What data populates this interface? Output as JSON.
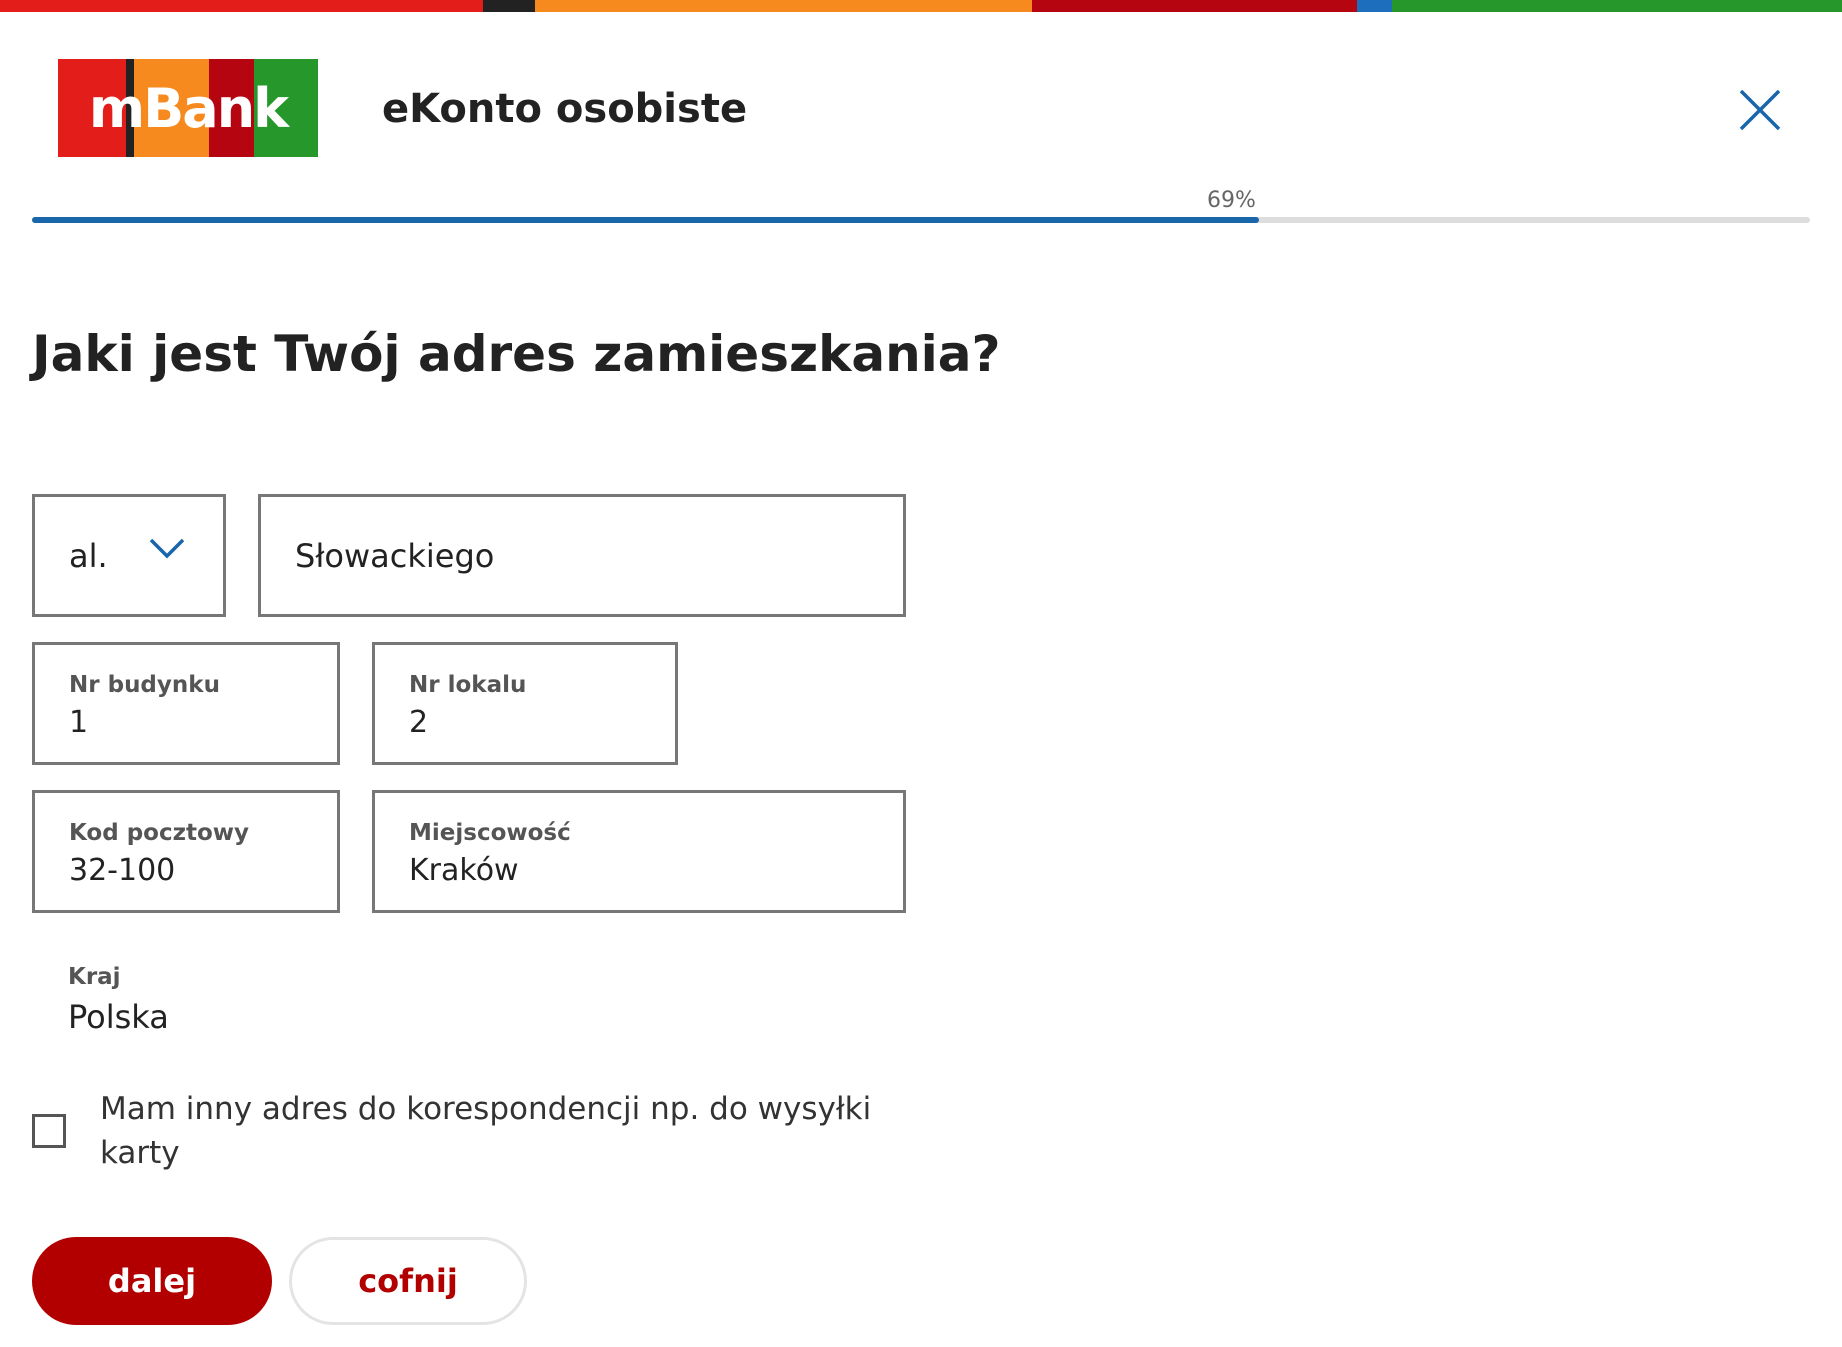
{
  "colors": {
    "stripe": [
      "#e31d1a",
      "#222222",
      "#f68a1e",
      "#b50510",
      "#1d6fbd",
      "#26972a"
    ],
    "logo_segments": [
      "#e31d1a",
      "#222222",
      "#f68a1e",
      "#b50510",
      "#26972a"
    ],
    "accent": "#1a66aa",
    "primary_button": "#b20000"
  },
  "header": {
    "logo_text": "mBank",
    "product_title": "eKonto osobiste",
    "close_icon": "close-icon"
  },
  "progress": {
    "label": "69%",
    "value_percent": 69
  },
  "page": {
    "title": "Jaki jest Twój adres zamieszkania?"
  },
  "form": {
    "street_type": {
      "selected": "al.",
      "icon": "chevron-down-icon"
    },
    "street_name": {
      "value": "Słowackiego"
    },
    "building_number": {
      "label": "Nr budynku",
      "value": "1"
    },
    "apartment_number": {
      "label": "Nr lokalu",
      "value": "2"
    },
    "postal_code": {
      "label": "Kod pocztowy",
      "value": "32-100"
    },
    "city": {
      "label": "Miejscowość",
      "value": "Kraków"
    },
    "country": {
      "label": "Kraj",
      "value": "Polska"
    },
    "correspondence_checkbox": {
      "label": "Mam inny adres do korespondencji np. do wysyłki karty",
      "checked": false
    }
  },
  "actions": {
    "next_label": "dalej",
    "back_label": "cofnij"
  }
}
